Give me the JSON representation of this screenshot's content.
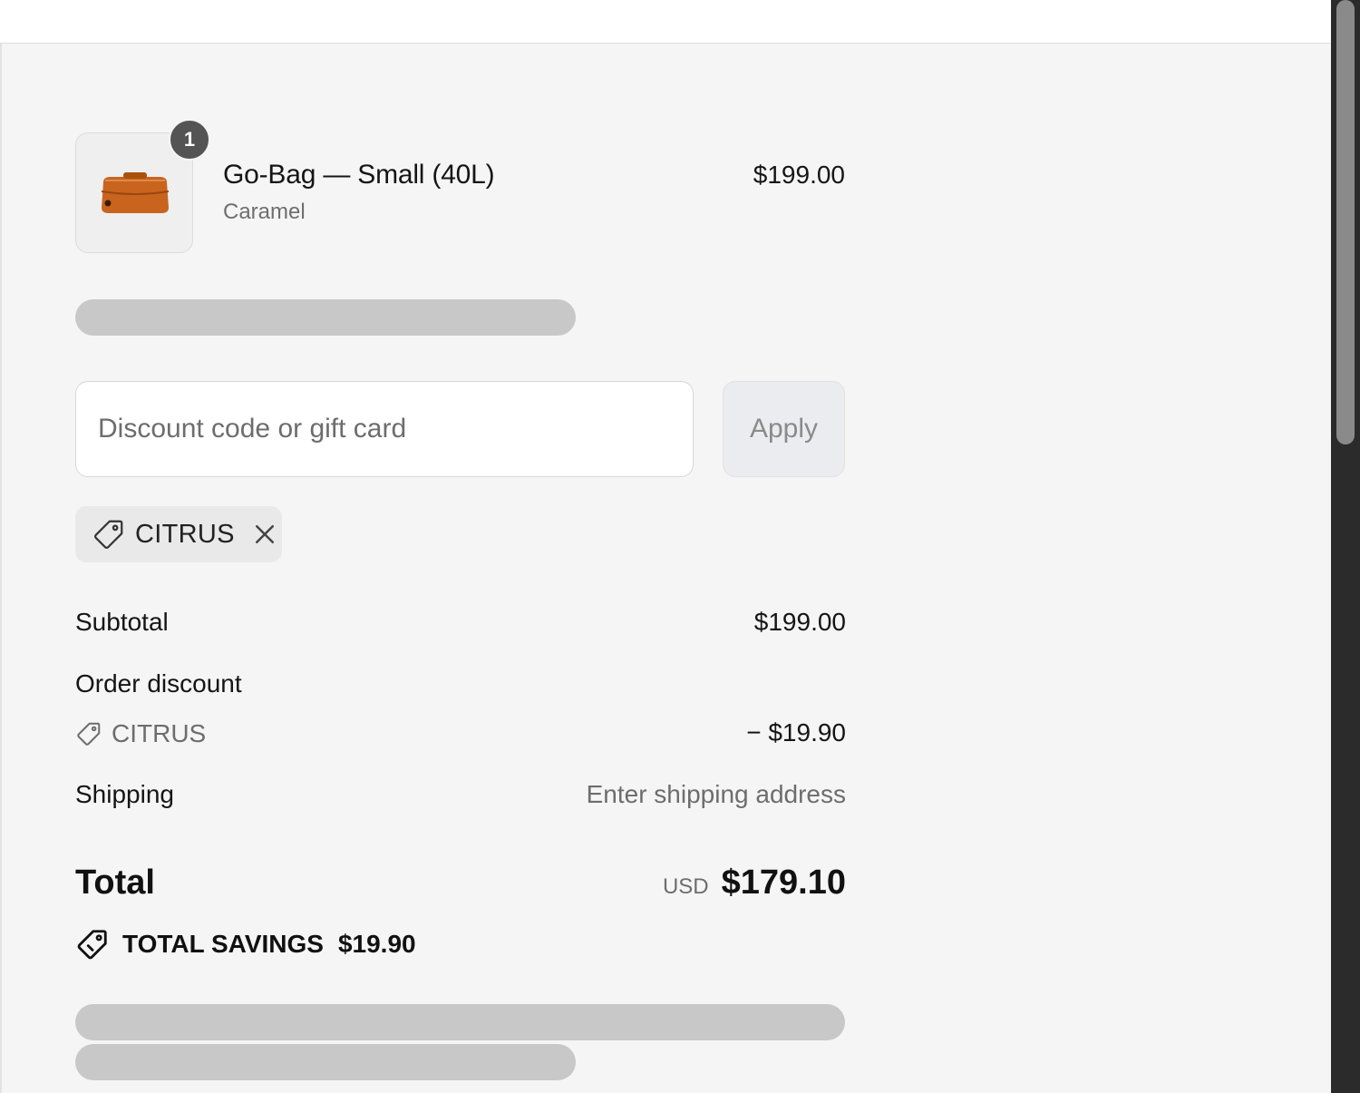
{
  "cart": {
    "item": {
      "quantity": "1",
      "name": "Go-Bag — Small (40L)",
      "variant": "Caramel",
      "price": "$199.00",
      "image_icon": "duffel-bag-image",
      "image_color": "#c8641e"
    }
  },
  "discount": {
    "placeholder": "Discount code or gift card",
    "value": "",
    "apply_label": "Apply",
    "applied_code": "CITRUS"
  },
  "summary": {
    "subtotal_label": "Subtotal",
    "subtotal_value": "$199.00",
    "order_discount_label": "Order discount",
    "discount_code": "CITRUS",
    "discount_value": "− $19.90",
    "shipping_label": "Shipping",
    "shipping_value": "Enter shipping address",
    "total_label": "Total",
    "currency": "USD",
    "total_value": "$179.10",
    "savings_label": "TOTAL SAVINGS",
    "savings_value": "$19.90"
  }
}
